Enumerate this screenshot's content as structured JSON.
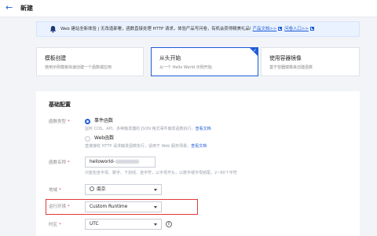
{
  "header": {
    "back_icon": "arrow-left-icon",
    "title": "新建"
  },
  "banner": {
    "icon": "bell-icon",
    "text": "Web 建站全新体验 | 无改造部署，函数直接处理 HTTP 请求，体验产品写问卷，有机会获得精美礼品!",
    "doc_link": "产品文档>>",
    "guide_link": "问卷入口>>"
  },
  "template_cards": [
    {
      "title": "模板创建",
      "subtitle": "使用示例模板快速创建一个函数或应用"
    },
    {
      "title": "从头开始",
      "subtitle": "从一个 Hello World 示例开始",
      "selected": true
    },
    {
      "title": "使用容器镜像",
      "subtitle": "基于容器镜像来创建函数"
    }
  ],
  "basic_config": {
    "title": "基础配置",
    "function_type": {
      "label": "函数类型",
      "options": [
        {
          "label": "事件函数",
          "selected": true,
          "hint": "监听 COS、API、多种触发器的 JSON 格式事件触发函数执行。",
          "hint_link": "查看文档"
        },
        {
          "label": "Web函数",
          "selected": false,
          "hint": "直接接收 HTTP 请求触发函数执行，适用于 Web 服务场景。",
          "hint_link": "查看文档"
        }
      ]
    },
    "function_name": {
      "label": "函数名称",
      "value": "helloworld-",
      "hint": "只能包含字母、数字、下划线、连字符，以字母开头，以数字或字母结尾，2~60个字符"
    },
    "region": {
      "label": "地域",
      "value": "南京"
    },
    "runtime": {
      "label": "运行环境",
      "value": "Custom Runtime"
    },
    "timezone": {
      "label": "时区",
      "value": "UTC"
    }
  },
  "colors": {
    "accent": "#1f5cd9",
    "highlight": "#e23a3a"
  }
}
